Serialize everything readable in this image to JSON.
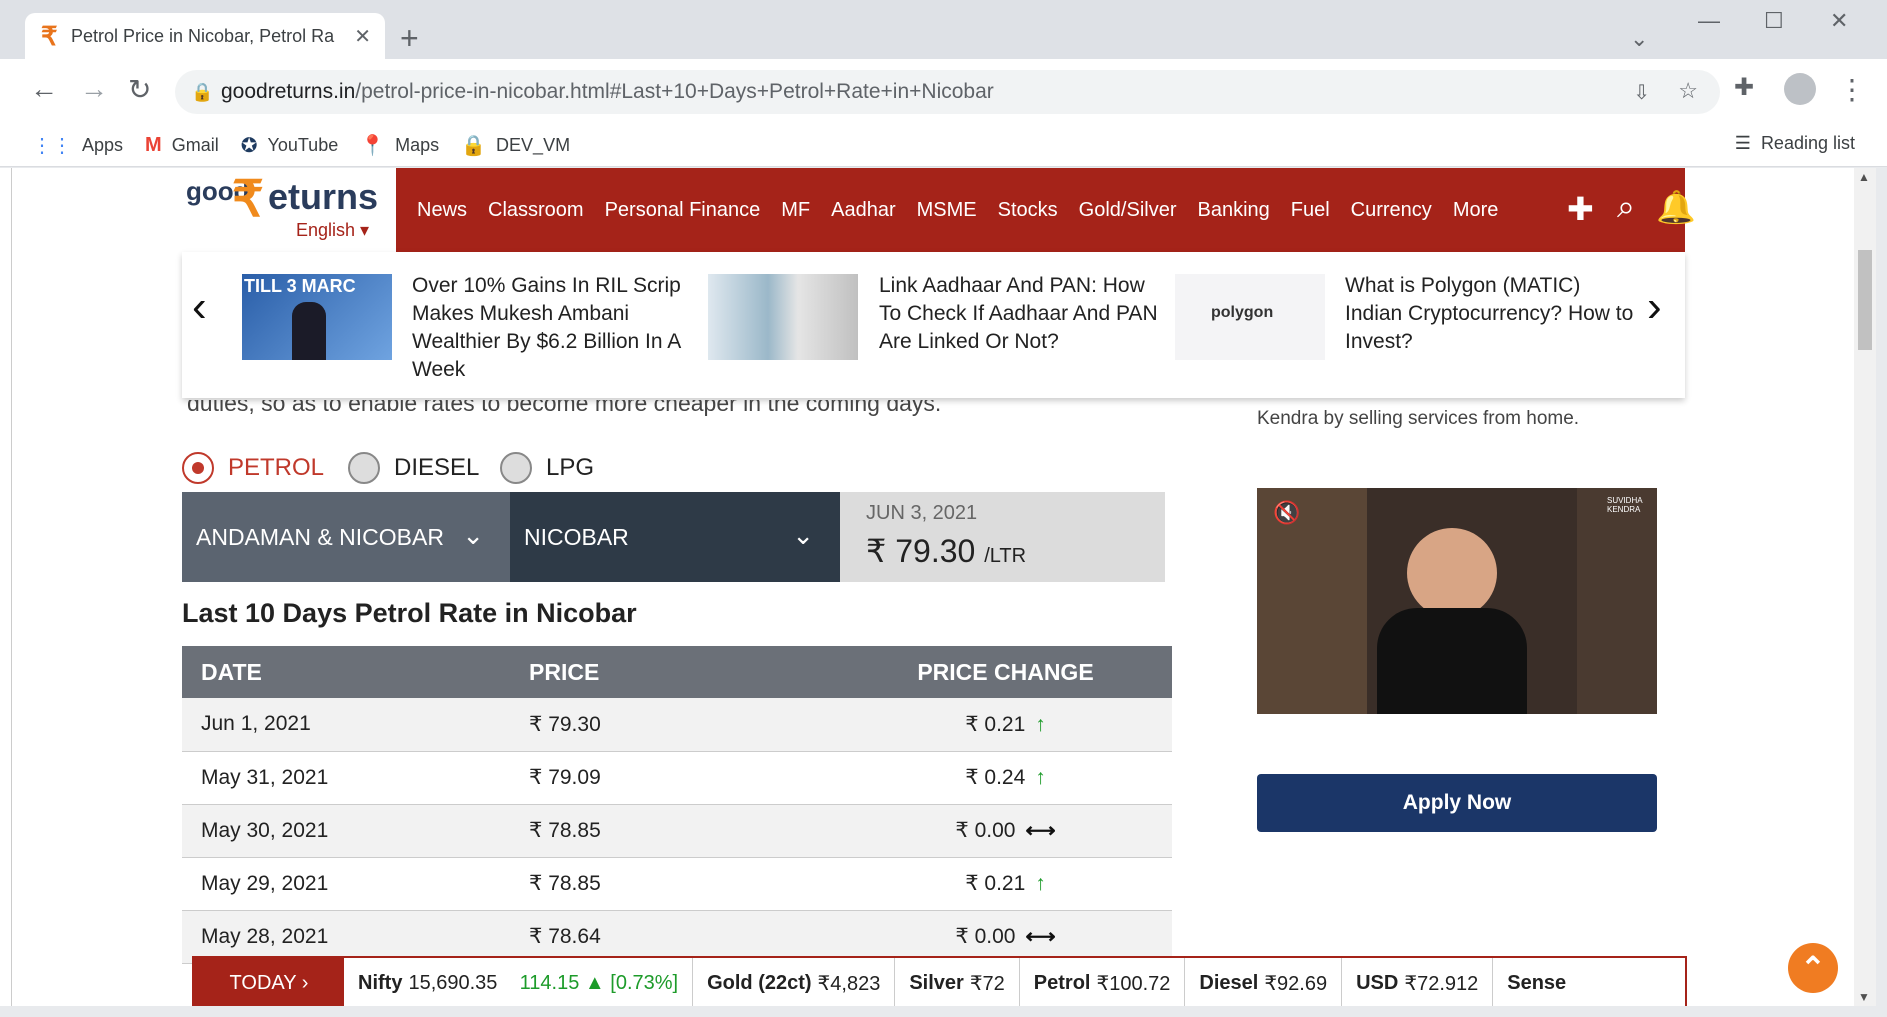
{
  "browser": {
    "tab_title": "Petrol Price in Nicobar, Petrol Ra",
    "tab_close": "✕",
    "new_tab": "+",
    "url_domain": "goodreturns.in",
    "url_path": "/petrol-price-in-nicobar.html#Last+10+Days+Petrol+Rate+in+Nicobar",
    "bookmarks": [
      "Apps",
      "Gmail",
      "YouTube",
      "Maps",
      "DEV_VM"
    ],
    "reading_list": "Reading list"
  },
  "site": {
    "logo_good": "good",
    "logo_rs": "₹",
    "logo_eturns": "eturns",
    "logo_lang": "English ▾",
    "menu": [
      "News",
      "Classroom",
      "Personal Finance",
      "MF",
      "Aadhar",
      "MSME",
      "Stocks",
      "Gold/Silver",
      "Banking",
      "Fuel",
      "Currency",
      "More"
    ]
  },
  "news": [
    {
      "text": "Over 10% Gains In RIL Scrip Makes Mukesh Ambani Wealthier By $6.2 Billion In A Week",
      "img_label": "TILL 3  MARC"
    },
    {
      "text": "Link Aadhaar And PAN: How To Check If Aadhaar And PAN Are Linked Or Not?",
      "img_label": ""
    },
    {
      "text": "What is Polygon (MATIC) Indian Cryptocurrency? How to Invest?",
      "img_label": "polygon"
    }
  ],
  "content": {
    "cut_text": "duties, so as to enable rates to become more cheaper in the coming days.",
    "fuel_tabs": [
      "PETROL",
      "DIESEL",
      "LPG"
    ],
    "state": "ANDAMAN & NICOBAR",
    "city": "NICOBAR",
    "price_date": "JUN 3, 2021",
    "price": "₹ 79.30",
    "price_unit": "/LTR",
    "table_title": "Last 10 Days Petrol Rate in Nicobar",
    "headers": [
      "DATE",
      "PRICE",
      "PRICE CHANGE"
    ],
    "rows": [
      {
        "date": "Jun 1, 2021",
        "price": "₹ 79.30",
        "change": "₹ 0.21",
        "dir": "up"
      },
      {
        "date": "May 31, 2021",
        "price": "₹ 79.09",
        "change": "₹ 0.24",
        "dir": "up"
      },
      {
        "date": "May 30, 2021",
        "price": "₹ 78.85",
        "change": "₹ 0.00",
        "dir": "flat"
      },
      {
        "date": "May 29, 2021",
        "price": "₹ 78.85",
        "change": "₹ 0.21",
        "dir": "up"
      },
      {
        "date": "May 28, 2021",
        "price": "₹ 78.64",
        "change": "₹ 0.00",
        "dir": "flat"
      }
    ]
  },
  "sidebar": {
    "kendra_text": "Kendra by selling services from home.",
    "video_badge": "SUVIDHA KENDRA",
    "apply_label": "Apply Now"
  },
  "ticker": {
    "today": "TODAY  ›",
    "items": [
      {
        "name": "Nifty",
        "value": "15,690.35",
        "change": "114.15 ▲ [0.73%]"
      },
      {
        "name": "Gold (22ct)",
        "value": "₹4,823",
        "change": ""
      },
      {
        "name": "Silver",
        "value": "₹72",
        "change": ""
      },
      {
        "name": "Petrol",
        "value": "₹100.72",
        "change": ""
      },
      {
        "name": "Diesel",
        "value": "₹92.69",
        "change": ""
      },
      {
        "name": "USD",
        "value": "₹72.912",
        "change": ""
      },
      {
        "name": "Sense",
        "value": "",
        "change": ""
      }
    ]
  },
  "colors": {
    "brand": "#a52319",
    "accent": "#f08a1c",
    "up": "#1d9b2a"
  }
}
